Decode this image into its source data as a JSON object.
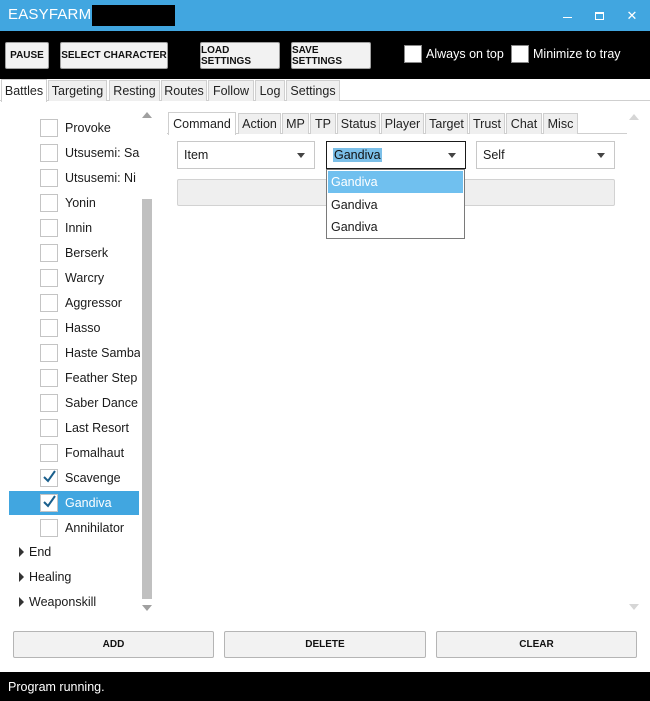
{
  "window": {
    "title": "EASYFARM -",
    "minimize_glyph": "",
    "close_glyph": "✕"
  },
  "toolbar": {
    "pause_label": "PAUSE",
    "select_character_label": "SELECT CHARACTER",
    "load_settings_label": "LOAD SETTINGS",
    "save_settings_label": "SAVE SETTINGS",
    "always_on_top_label": "Always on top",
    "always_on_top_checked": false,
    "minimize_to_tray_label": "Minimize to tray",
    "minimize_to_tray_checked": false
  },
  "main_tabs": [
    {
      "label": "Battles",
      "active": true
    },
    {
      "label": "Targeting",
      "active": false
    },
    {
      "label": "Resting",
      "active": false
    },
    {
      "label": "Routes",
      "active": false
    },
    {
      "label": "Follow",
      "active": false
    },
    {
      "label": "Log",
      "active": false
    },
    {
      "label": "Settings",
      "active": false
    }
  ],
  "tree": {
    "items": [
      {
        "label": "Provoke",
        "checked": false,
        "selected": false
      },
      {
        "label": "Utsusemi: San",
        "checked": false,
        "selected": false
      },
      {
        "label": "Utsusemi: Ni",
        "checked": false,
        "selected": false
      },
      {
        "label": "Yonin",
        "checked": false,
        "selected": false
      },
      {
        "label": "Innin",
        "checked": false,
        "selected": false
      },
      {
        "label": "Berserk",
        "checked": false,
        "selected": false
      },
      {
        "label": "Warcry",
        "checked": false,
        "selected": false
      },
      {
        "label": "Aggressor",
        "checked": false,
        "selected": false
      },
      {
        "label": "Hasso",
        "checked": false,
        "selected": false
      },
      {
        "label": "Haste Samba",
        "checked": false,
        "selected": false
      },
      {
        "label": "Feather Step",
        "checked": false,
        "selected": false
      },
      {
        "label": "Saber Dance",
        "checked": false,
        "selected": false
      },
      {
        "label": "Last Resort",
        "checked": false,
        "selected": false
      },
      {
        "label": "Fomalhaut",
        "checked": false,
        "selected": false
      },
      {
        "label": "Scavenge",
        "checked": true,
        "selected": false
      },
      {
        "label": "Gandiva",
        "checked": true,
        "selected": true
      },
      {
        "label": "Annihilator",
        "checked": false,
        "selected": false
      }
    ],
    "groups": [
      {
        "label": "End"
      },
      {
        "label": "Healing"
      },
      {
        "label": "Weaponskill"
      }
    ]
  },
  "sub_tabs": [
    {
      "label": "Command",
      "active": true
    },
    {
      "label": "Action",
      "active": false
    },
    {
      "label": "MP",
      "active": false
    },
    {
      "label": "TP",
      "active": false
    },
    {
      "label": "Status",
      "active": false
    },
    {
      "label": "Player",
      "active": false
    },
    {
      "label": "Target",
      "active": false
    },
    {
      "label": "Trust",
      "active": false
    },
    {
      "label": "Chat",
      "active": false
    },
    {
      "label": "Misc",
      "active": false
    }
  ],
  "command": {
    "type_value": "Item",
    "name_value": "Gandiva",
    "target_value": "Self",
    "command_text": "",
    "name_dropdown_options": [
      "Gandiva",
      "Gandiva",
      "Gandiva"
    ]
  },
  "bottom": {
    "add_label": "ADD",
    "delete_label": "DELETE",
    "clear_label": "CLEAR"
  },
  "status": {
    "text": "Program running."
  },
  "colors": {
    "title_bar": "#41a6e0",
    "selection": "#41a6e0",
    "dropdown_highlight": "#70c0ef",
    "checkmark": "#1a5f8c"
  }
}
